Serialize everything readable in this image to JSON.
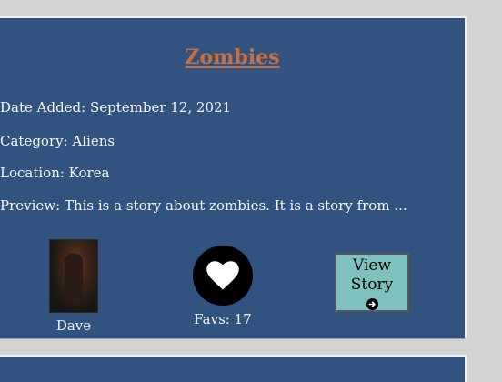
{
  "story": {
    "title": "Zombies",
    "date_added": "Date Added: September 12, 2021",
    "category": "Category: Aliens",
    "location": "Location: Korea",
    "preview": "Preview: This is a story about zombies. It is a story from ...",
    "author_name": "Dave",
    "favs": "Favs: 17",
    "view_button_line1": "View",
    "view_button_line2": "Story"
  },
  "icons": {
    "favorite": "heart-icon",
    "view": "arrow-right-circle-icon"
  },
  "colors": {
    "page_background": "#d3d3d3",
    "card_background": "#325380",
    "title": "#c86f3c",
    "button_background": "#7fc1bf"
  }
}
